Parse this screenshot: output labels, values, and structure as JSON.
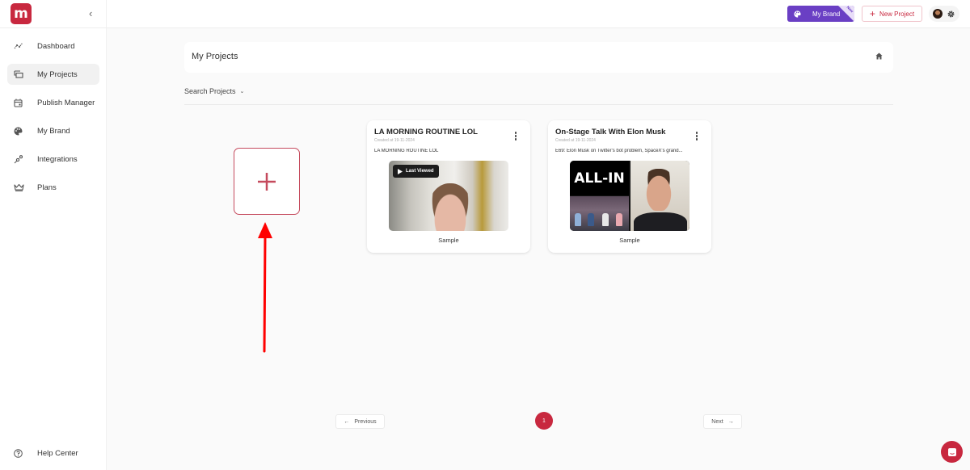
{
  "app": {
    "logo_letter": "m",
    "collapse_icon": "chevron-left"
  },
  "sidebar": {
    "items": [
      {
        "label": "Dashboard",
        "icon": "chart-line-icon",
        "active": false
      },
      {
        "label": "My Projects",
        "icon": "folder-stack-icon",
        "active": true
      },
      {
        "label": "Publish Manager",
        "icon": "calendar-icon",
        "active": false
      },
      {
        "label": "My Brand",
        "icon": "palette-icon",
        "active": false
      },
      {
        "label": "Integrations",
        "icon": "plug-icon",
        "active": false
      },
      {
        "label": "Plans",
        "icon": "crown-icon",
        "active": false
      }
    ],
    "help_label": "Help Center"
  },
  "topbar": {
    "brand_label": "My Brand",
    "brand_ribbon": "New",
    "new_project_label": "New Project",
    "brand_color": "#6a3fc4",
    "accent_color": "#c8283f"
  },
  "main": {
    "title": "My Projects",
    "search_label": "Search Projects",
    "projects": [
      {
        "title": "LA MORNING ROUTINE LOL",
        "created": "Created at 19-11-2024",
        "description": "LA MORNING ROUTINE LOL",
        "badge": "Last Viewed",
        "tag": "Sample"
      },
      {
        "title": "On-Stage Talk With Elon Musk",
        "created": "Created at 19-11-2024",
        "description": "E69: Elon Musk on Twitter's bot problem, SpaceX's grand...",
        "thumb_text": "ALL-IN",
        "tag": "Sample"
      }
    ]
  },
  "pagination": {
    "previous_label": "Previous",
    "next_label": "Next",
    "current_page": "1"
  }
}
